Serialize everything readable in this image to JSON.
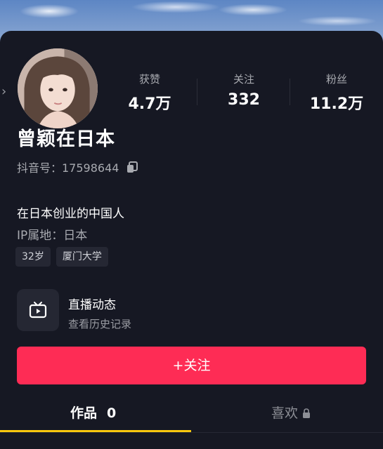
{
  "profile": {
    "name": "曾颖在日本",
    "douyin_id": "抖音号：17598644",
    "bio": "在日本创业的中国人",
    "ip_location": "IP属地：日本",
    "tags": [
      "32岁",
      "厦门大学"
    ]
  },
  "stats": [
    {
      "label": "获赞",
      "value": "4.7万"
    },
    {
      "label": "关注",
      "value": "332"
    },
    {
      "label": "粉丝",
      "value": "11.2万"
    }
  ],
  "live": {
    "title": "直播动态",
    "subtitle": "查看历史记录",
    "icon": "tv-icon"
  },
  "follow_button": "+关注",
  "tabs": [
    {
      "label": "作品",
      "count": "0",
      "active": true
    },
    {
      "label": "喜欢",
      "locked": true,
      "active": false
    }
  ],
  "side_arrow": "›",
  "colors": {
    "background": "#161823",
    "accent": "#fe2c55",
    "tab_indicator": "#f9c80e",
    "secondary_text": "#a8aab0"
  }
}
